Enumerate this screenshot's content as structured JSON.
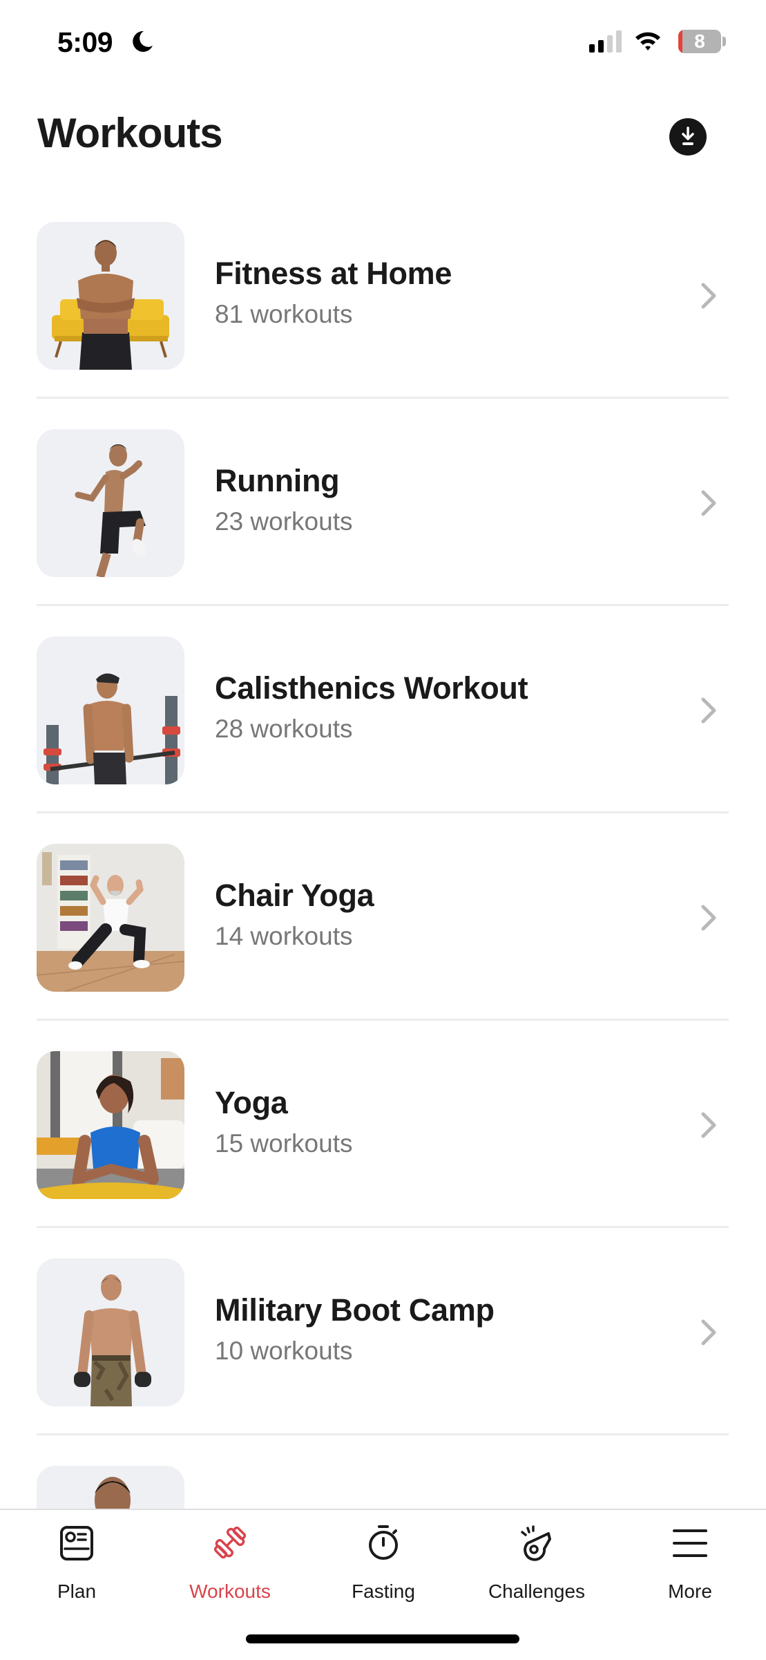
{
  "status_bar": {
    "time": "5:09",
    "focus_icon": "moon-icon",
    "battery_percent": "8",
    "icons": [
      "cellular-signal-icon",
      "wifi-icon",
      "battery-icon"
    ]
  },
  "header": {
    "title": "Workouts",
    "download_icon": "download-icon"
  },
  "workouts": [
    {
      "title": "Fitness at Home",
      "count": "81 workouts",
      "thumb": "fitness-at-home-thumbnail"
    },
    {
      "title": "Running",
      "count": "23 workouts",
      "thumb": "running-thumbnail"
    },
    {
      "title": "Calisthenics Workout",
      "count": "28 workouts",
      "thumb": "calisthenics-thumbnail"
    },
    {
      "title": "Chair Yoga",
      "count": "14 workouts",
      "thumb": "chair-yoga-thumbnail"
    },
    {
      "title": "Yoga",
      "count": "15 workouts",
      "thumb": "yoga-thumbnail"
    },
    {
      "title": "Military Boot Camp",
      "count": "10 workouts",
      "thumb": "military-boot-camp-thumbnail"
    },
    {
      "title": "",
      "count": "",
      "thumb": "partial-thumbnail"
    }
  ],
  "tab_bar": {
    "active_color": "#d9434b",
    "tabs": [
      {
        "label": "Plan",
        "icon": "plan-icon",
        "active": false
      },
      {
        "label": "Workouts",
        "icon": "dumbbell-icon",
        "active": true
      },
      {
        "label": "Fasting",
        "icon": "stopwatch-icon",
        "active": false
      },
      {
        "label": "Challenges",
        "icon": "whistle-icon",
        "active": false
      },
      {
        "label": "More",
        "icon": "menu-icon",
        "active": false
      }
    ]
  }
}
